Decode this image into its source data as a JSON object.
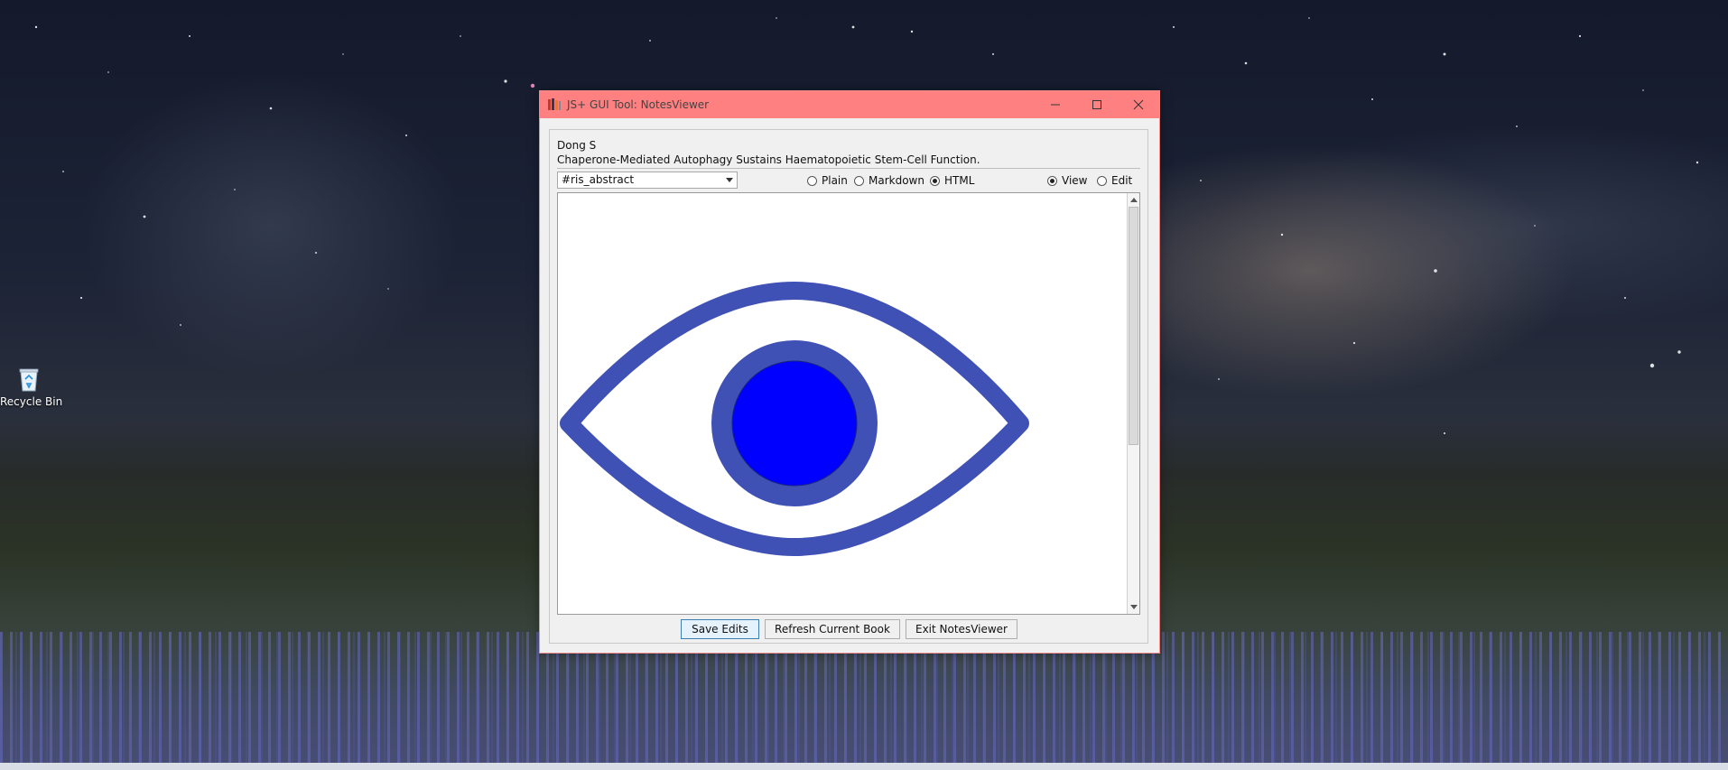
{
  "desktop": {
    "recycle_bin_label": "Recycle Bin"
  },
  "window": {
    "title": "JS+ GUI Tool:  NotesViewer",
    "title_bar_color": "#ff8080",
    "icons": [
      "app-icon",
      "minimize-icon",
      "maximize-icon",
      "close-icon"
    ]
  },
  "record": {
    "author": "Dong S",
    "title": "Chaperone-Mediated Autophagy Sustains Haematopoietic Stem-Cell Function."
  },
  "field_select": {
    "selected": "#ris_abstract"
  },
  "format_options": [
    {
      "label": "Plain",
      "selected": false
    },
    {
      "label": "Markdown",
      "selected": false
    },
    {
      "label": "HTML",
      "selected": true
    }
  ],
  "mode_options": [
    {
      "label": "View",
      "selected": true
    },
    {
      "label": "Edit",
      "selected": false
    }
  ],
  "viewer": {
    "content_icon": "eye-icon",
    "eye_outline_color": "#3f51b5",
    "iris_color": "#3f51b5",
    "pupil_color": "#0000ff"
  },
  "buttons": {
    "save": "Save Edits",
    "refresh": "Refresh Current Book",
    "exit": "Exit NotesViewer"
  }
}
